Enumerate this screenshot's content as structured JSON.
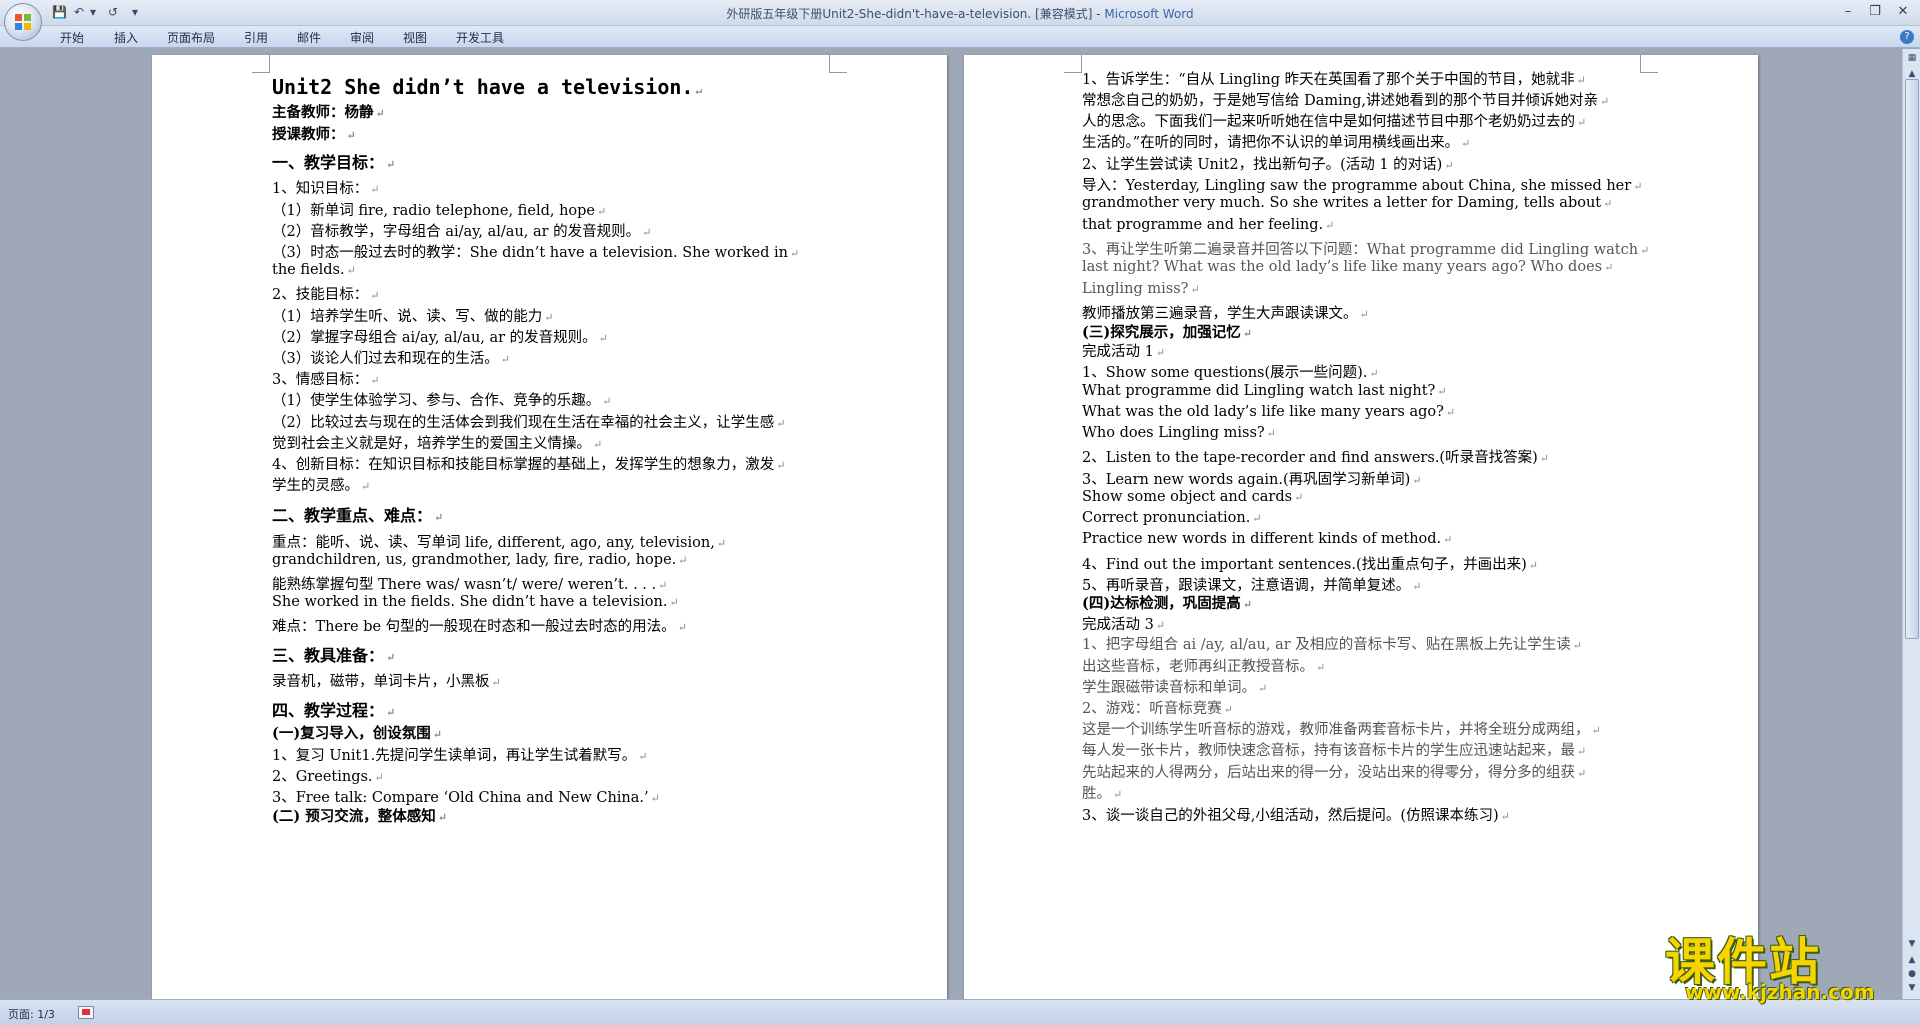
{
  "window": {
    "title_doc": "外研版五年级下册Unit2-She-didn't-have-a-television. [兼容模式] - ",
    "title_app": "Microsoft Word"
  },
  "ribbon": {
    "tabs": [
      "开始",
      "插入",
      "页面布局",
      "引用",
      "邮件",
      "审阅",
      "视图",
      "开发工具"
    ]
  },
  "status": {
    "page": "页面: 1/3"
  },
  "page1": {
    "lines": [
      "Unit2 She didn’t have a television.",
      "主备教师：杨静",
      "授课教师：",
      "一、教学目标：",
      "1、知识目标：",
      "（1）新单词 fire, radio telephone, field, hope",
      "（2）音标教学，字母组合 ai/ay, al/au, ar 的发音规则。",
      "（3）时态一般过去时的教学：She didn’t have a television. She worked in",
      "the fields.",
      "2、技能目标：",
      "（1）培养学生听、说、读、写、做的能力",
      "（2）掌握字母组合 ai/ay, al/au, ar 的发音规则。",
      "（3）谈论人们过去和现在的生活。",
      "3、情感目标：",
      "（1）使学生体验学习、参与、合作、竞争的乐趣。",
      "（2）比较过去与现在的生活体会到我们现在生活在幸福的社会主义，让学生感",
      "觉到社会主义就是好，培养学生的爱国主义情操。",
      "4、创新目标：在知识目标和技能目标掌握的基础上，发挥学生的想象力，激发",
      "学生的灵感。",
      "二、教学重点、难点：",
      "   重点：能听、说、读、写单词 life,  different,  ago,  any, television,",
      "grandchildren,  us,  grandmother,  lady,  fire,  radio, hope.",
      "能熟练掌握句型 There  was/ wasn’t/ were/ weren’t. . . .",
      "She worked in the fields.  She didn’t have a television.",
      "   难点：There be 句型的一般现在时态和一般过去时态的用法。",
      "三、教具准备：",
      "    录音机，磁带，单词卡片，小黑板",
      "四、教学过程：",
      " (一)复习导入，创设氛围",
      "1、复习 Unit1.先提问学生读单词，再让学生试着默写。",
      "2、Greetings.",
      "3、Free talk: Compare  ‘Old China and New China.’",
      "(二) 预习交流，整体感知"
    ]
  },
  "page2": {
    "lines": [
      "1、告诉学生：“自从 Lingling 昨天在英国看了那个关于中国的节目，她就非",
      "常想念自己的奶奶，于是她写信给 Daming,讲述她看到的那个节目并倾诉她对亲",
      "人的思念。下面我们一起来听听她在信中是如何描述节目中那个老奶奶过去的",
      "生活的。”在听的同时，请把你不认识的单词用横线画出来。",
      "2、让学生尝试读 Unit2，找出新句子。(活动 1 的对话)",
      "导入：Yesterday, Lingling saw the programme about China, she missed her",
      "grandmother very much.  So she writes a letter for Daming, tells about",
      "that programme and her feeling.",
      "3、再让学生听第二遍录音并回答以下问题：What programme did Lingling watch",
      "last night? What was the old lady’s life like many years ago? Who does",
      "Lingling miss?",
      "教师播放第三遍录音，学生大声跟读课文。",
      "(三)探究展示，加强记忆",
      " 完成活动 1",
      "1、Show some questions(展示一些问题).",
      "What programme did Lingling watch last night?",
      "What was the old lady’s life like many years ago?",
      "Who does Lingling miss?",
      "2、Listen to the tape-recorder and find answers.(听录音找答案)",
      "3、Learn new words again.(再巩固学习新单词)",
      "Show some object and cards",
      "Correct pronunciation.",
      "Practice new words in different kinds of method.",
      "4、Find out the important sentences.(找出重点句子，并画出来)",
      "5、再听录音，跟读课文，注意语调，并简单复述。",
      "(四)达标检测，巩固提高",
      "完成活动 3",
      "1、把字母组合 ai /ay, al/au, ar 及相应的音标卡写、贴在黑板上先让学生读",
      "出这些音标，老师再纠正教授音标。",
      "学生跟磁带读音标和单词。",
      "2、游戏：听音标竞赛",
      "这是一个训练学生听音标的游戏，教师准备两套音标卡片，并将全班分成两组，",
      "每人发一张卡片，教师快速念音标，持有该音标卡片的学生应迅速站起来，最",
      "先站起来的人得两分，后站出来的得一分，没站出来的得零分，得分多的组获",
      "胜。",
      "3、谈一谈自己的外祖父母,小组活动，然后提问。(仿照课本练习)"
    ]
  },
  "watermark": {
    "text": "课件站",
    "url": "www.kjzhan.com"
  },
  "colors": {
    "page_bg": "#ffffff",
    "workspace": "#9ea8b7",
    "chrome": "#d2def0",
    "watermark": "#f7d400"
  }
}
